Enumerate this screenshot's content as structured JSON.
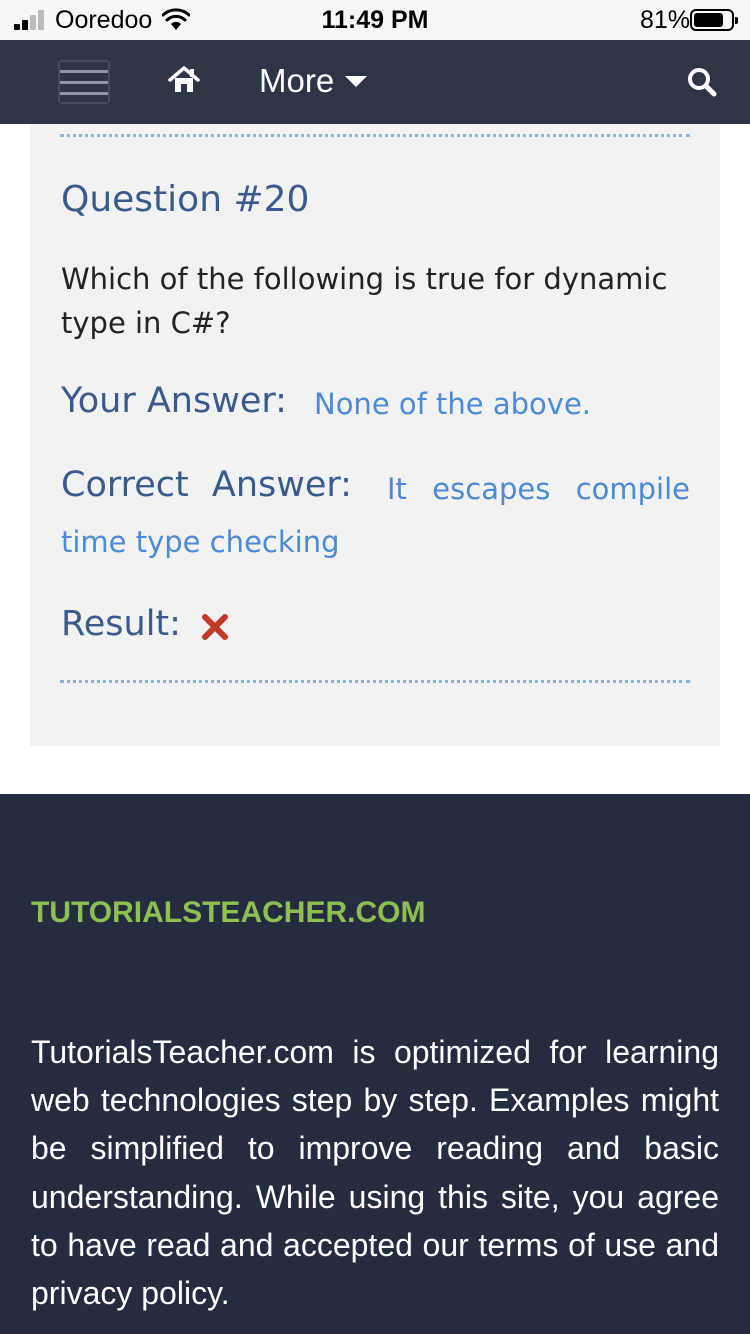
{
  "status_bar": {
    "carrier": "Ooredoo",
    "time": "11:49 PM",
    "battery_percent": "81%",
    "battery_level": 0.81,
    "icons": [
      "signal-icon",
      "wifi-icon",
      "battery-icon"
    ]
  },
  "navbar": {
    "menu_icon": "hamburger-menu-icon",
    "home_icon": "home-icon",
    "more_label": "More",
    "search_icon": "search-icon",
    "background": "#2e3547"
  },
  "question": {
    "title": "Question #20",
    "text": "Which of the following is true for dynamic type in C#?",
    "your_answer_label": "Your Answer:",
    "your_answer_value": "None of the above.",
    "correct_answer_label": "Correct Answer:",
    "correct_answer_line1": "It escapes compile",
    "correct_answer_line2": "time type checking",
    "result_label": "Result:",
    "result_icon": "wrong-cross-icon",
    "result_correct": false
  },
  "footer": {
    "brand": "TUTORIALSTEACHER.COM",
    "description": "TutorialsTeacher.com is optimized for learning web technologies step by step. Examples might be simplified to improve reading and basic understanding. While using this site, you agree to have read and accepted our terms of use and privacy policy."
  },
  "colors": {
    "heading_blue": "#3a5a8c",
    "answer_blue": "#4a8ad6",
    "brand_green": "#8cc152",
    "footer_bg": "#262c40",
    "error_red": "#c0392b"
  }
}
